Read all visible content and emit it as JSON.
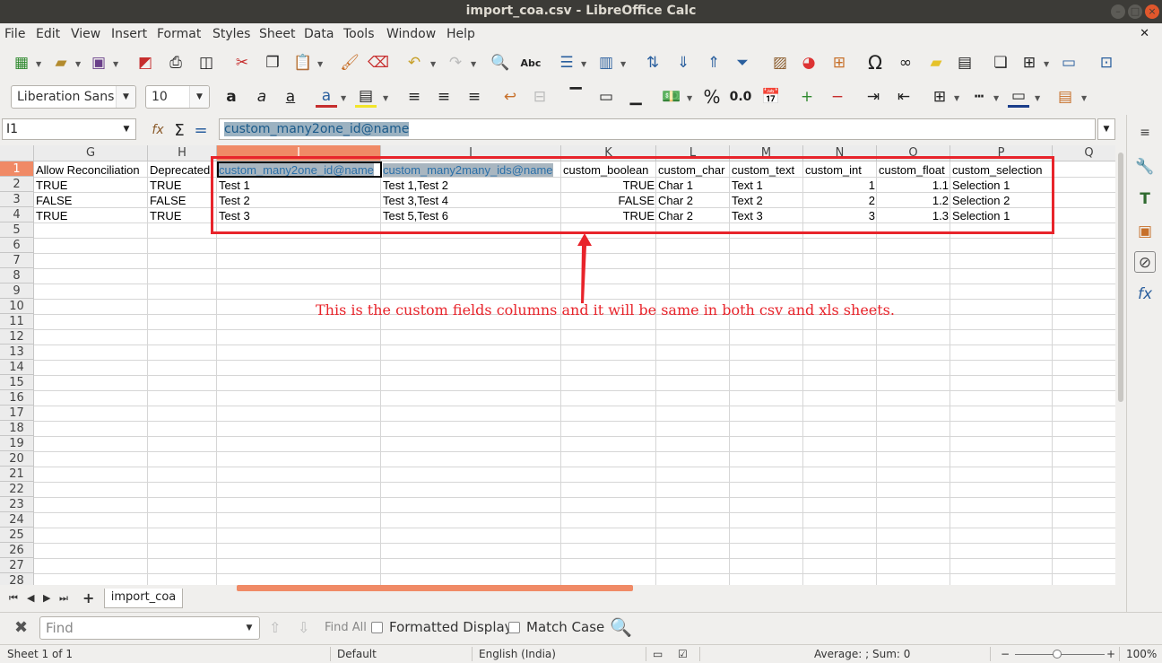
{
  "window": {
    "title": "import_coa.csv - LibreOffice Calc"
  },
  "menu": [
    "File",
    "Edit",
    "View",
    "Insert",
    "Format",
    "Styles",
    "Sheet",
    "Data",
    "Tools",
    "Window",
    "Help"
  ],
  "font": {
    "name": "Liberation Sans",
    "size": "10"
  },
  "formula_bar": {
    "cell_ref": "I1",
    "content": "custom_many2one_id@name"
  },
  "columns": [
    "G",
    "H",
    "I",
    "J",
    "K",
    "L",
    "M",
    "N",
    "O",
    "P",
    "Q"
  ],
  "rows": [
    "1",
    "2",
    "3",
    "4",
    "5",
    "6",
    "7",
    "8",
    "9",
    "10",
    "11",
    "12",
    "13",
    "14",
    "15",
    "16",
    "17",
    "18",
    "19",
    "20",
    "21",
    "22",
    "23",
    "24",
    "25",
    "26",
    "27",
    "28"
  ],
  "cells": {
    "r1": [
      "Allow Reconciliation",
      "Deprecated",
      "custom_many2one_id@name",
      "custom_many2many_ids@name",
      "custom_boolean",
      "custom_char",
      "custom_text",
      "custom_int",
      "custom_float",
      "custom_selection"
    ],
    "r2": [
      "TRUE",
      "TRUE",
      "Test 1",
      "Test 1,Test 2",
      "TRUE",
      "Char 1",
      "Text 1",
      "1",
      "1.1",
      "Selection 1"
    ],
    "r3": [
      "FALSE",
      "FALSE",
      "Test 2",
      "Test 3,Test 4",
      "FALSE",
      "Char 2",
      "Text 2",
      "2",
      "1.2",
      "Selection 2"
    ],
    "r4": [
      "TRUE",
      "TRUE",
      "Test 3",
      "Test 5,Test 6",
      "TRUE",
      "Char 2",
      "Text 3",
      "3",
      "1.3",
      "Selection 1"
    ]
  },
  "annotation": "This is the custom fields columns and it will be same in both csv and xls sheets.",
  "sheet_tab": "import_coa",
  "findbar": {
    "placeholder": "Find",
    "find_all": "Find All",
    "formatted_display": "Formatted Display",
    "match_case": "Match Case"
  },
  "status": {
    "sheet": "Sheet 1 of 1",
    "style": "Default",
    "language": "English (India)",
    "summary": "Average: ; Sum: 0",
    "zoom": "100%"
  }
}
